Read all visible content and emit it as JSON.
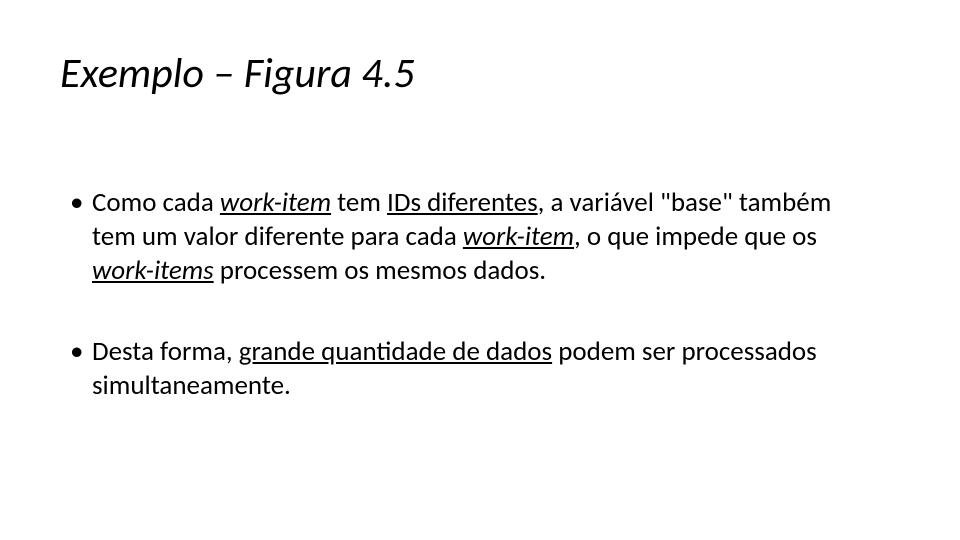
{
  "slide": {
    "title": "Exemplo – Figura 4.5",
    "bullets": [
      {
        "segments": [
          {
            "t": "Como cada "
          },
          {
            "t": "work-item",
            "cls": "wi"
          },
          {
            "t": " tem "
          },
          {
            "t": "IDs diferentes",
            "cls": "u"
          },
          {
            "t": ", a variável \"base\" também tem um valor diferente para cada "
          },
          {
            "t": "work-item",
            "cls": "wi"
          },
          {
            "t": ", o que impede que os "
          },
          {
            "t": "work-items",
            "cls": "wi"
          },
          {
            "t": " processem os mesmos dados."
          }
        ]
      },
      {
        "segments": [
          {
            "t": "Desta forma, "
          },
          {
            "t": "grande quantidade de dados",
            "cls": "u"
          },
          {
            "t": " podem ser processados simultaneamente."
          }
        ]
      }
    ]
  }
}
